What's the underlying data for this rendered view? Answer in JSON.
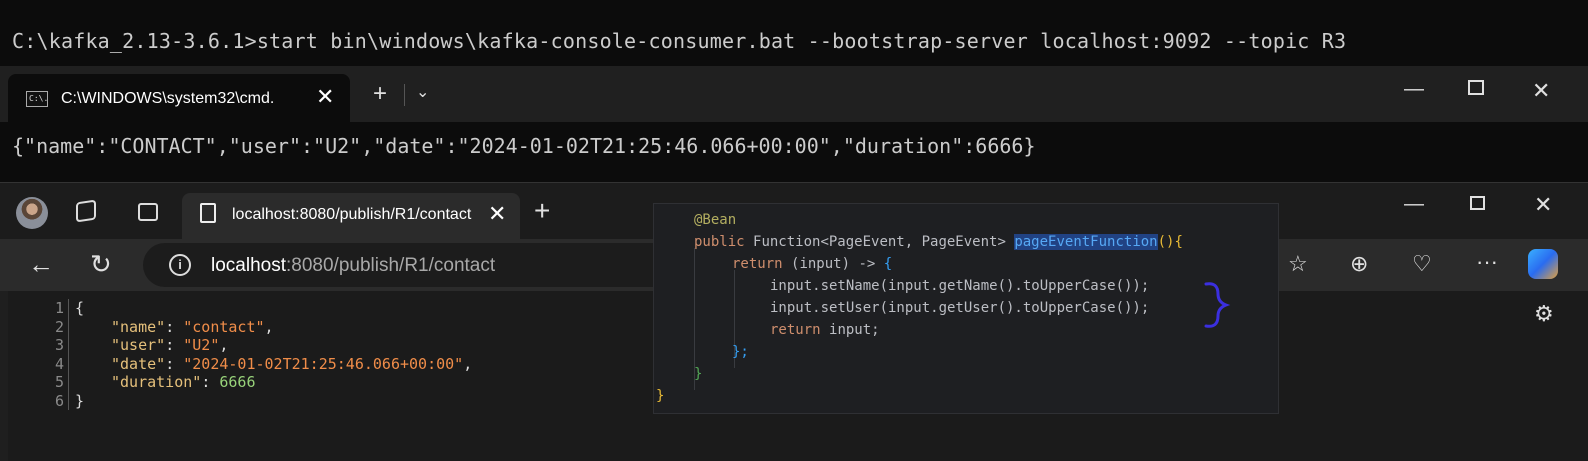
{
  "console_top": {
    "command": "C:\\kafka_2.13-3.6.1>start bin\\windows\\kafka-console-consumer.bat --bootstrap-server localhost:9092 --topic R3"
  },
  "terminal": {
    "tab_title": "C:\\WINDOWS\\system32\\cmd.",
    "tab_icon_text": "C:\\.",
    "output": "{\"name\":\"CONTACT\",\"user\":\"U2\",\"date\":\"2024-01-02T21:25:46.066+00:00\",\"duration\":6666}"
  },
  "browser": {
    "tab_title": "localhost:8080/publish/R1/contact",
    "url_host": "localhost",
    "url_rest": ":8080/publish/R1/contact",
    "json_lines": [
      {
        "n": "1",
        "text": "{"
      },
      {
        "n": "2",
        "key": "\"name\"",
        "value": "\"contact\"",
        "suffix": ","
      },
      {
        "n": "3",
        "key": "\"user\"",
        "value": "\"U2\"",
        "suffix": ","
      },
      {
        "n": "4",
        "key": "\"date\"",
        "value": "\"2024-01-02T21:25:46.066+00:00\"",
        "suffix": ","
      },
      {
        "n": "5",
        "key": "\"duration\"",
        "value": "6666",
        "suffix": ""
      },
      {
        "n": "6",
        "text": "}"
      }
    ]
  },
  "ide": {
    "annotation": "@Bean",
    "l2_public": "public ",
    "l2_type": "Function<PageEvent, PageEvent> ",
    "l2_fn": "pageEventFunction",
    "l2_paren": "()",
    "l2_brace": "{",
    "l3_return": "return ",
    "l3_lambda": "(input) -> ",
    "l3_brace": "{",
    "l4": "input.setName(input.getName().toUpperCase());",
    "l5": "input.setUser(input.getUser().toUpperCase());",
    "l6_return": "return ",
    "l6_rest": "input;",
    "l7": "};",
    "l8": "}",
    "l9": "}"
  },
  "colors": {
    "terminal_bg": "#0c0c0c",
    "ide_bg": "#1e1f22",
    "selection": "#214283",
    "annotation_pen": "#3b2fe0"
  }
}
